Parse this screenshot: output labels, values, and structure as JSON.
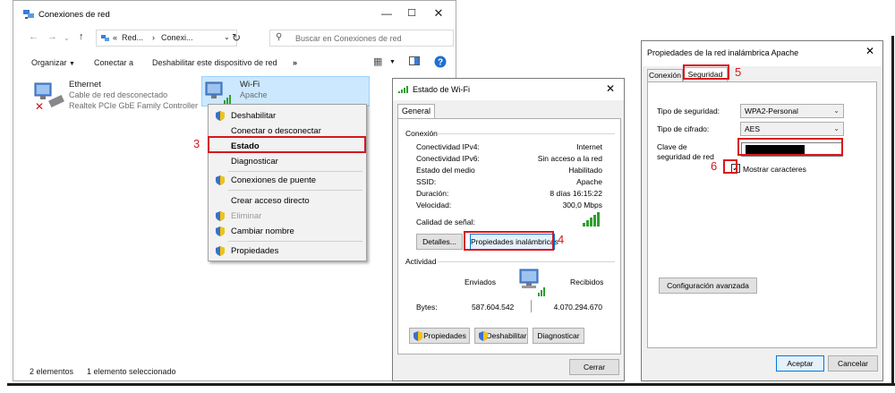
{
  "explorer": {
    "title": "Conexiones de red",
    "address": {
      "segment1": "Red...",
      "segment2": "Conexi...",
      "prefix": "«"
    },
    "search": {
      "placeholder": "Buscar en Conexiones de red"
    },
    "toolbar": {
      "organize": "Organizar",
      "connect": "Conectar a",
      "disable": "Deshabilitar este dispositivo de red",
      "more": "»"
    },
    "items": [
      {
        "name": "Ethernet",
        "line1": "Cable de red desconectado",
        "line2": "Realtek PCIe GbE Family Controller"
      },
      {
        "name": "Wi-Fi",
        "line1": "Apache"
      }
    ],
    "status": {
      "count": "2 elementos",
      "selected": "1 elemento seleccionado"
    }
  },
  "context_menu": {
    "items": [
      {
        "label": "Deshabilitar",
        "shield": true
      },
      {
        "label": "Conectar o desconectar"
      },
      {
        "label": "Estado",
        "bold": true
      },
      {
        "label": "Diagnosticar"
      },
      {
        "label": "Conexiones de puente",
        "shield": true
      },
      {
        "label": "Crear acceso directo"
      },
      {
        "label": "Eliminar",
        "shield": true,
        "disabled": true
      },
      {
        "label": "Cambiar nombre",
        "shield": true
      },
      {
        "label": "Propiedades",
        "shield": true
      }
    ]
  },
  "estado": {
    "title": "Estado de Wi-Fi",
    "tab": "General",
    "group_connection": "Conexión",
    "rows": [
      {
        "label": "Conectividad IPv4:",
        "value": "Internet"
      },
      {
        "label": "Conectividad IPv6:",
        "value": "Sin acceso a la red"
      },
      {
        "label": "Estado del medio",
        "value": "Habilitado"
      },
      {
        "label": "SSID:",
        "value": "Apache"
      },
      {
        "label": "Duración:",
        "value": "8 días 16:15:22"
      },
      {
        "label": "Velocidad:",
        "value": "300,0 Mbps"
      }
    ],
    "signal_label": "Calidad de señal:",
    "details_button": "Detalles...",
    "wireless_props_button": "Propiedades inalámbricas",
    "group_activity": "Actividad",
    "sent_label": "Enviados",
    "received_label": "Recibidos",
    "bytes_label": "Bytes:",
    "bytes_sent": "587.604.542",
    "bytes_received": "4.070.294.670",
    "props_button": "Propiedades",
    "disable_button": "Deshabilitar",
    "diagnose_button": "Diagnosticar",
    "close_button": "Cerrar"
  },
  "props": {
    "title": "Propiedades de la red inalámbrica Apache",
    "tab_connection": "Conexión",
    "tab_security": "Seguridad",
    "security_type_label": "Tipo de seguridad:",
    "security_type_value": "WPA2-Personal",
    "cipher_label": "Tipo de cifrado:",
    "cipher_value": "AES",
    "key_label": "Clave de seguridad de red",
    "show_chars_label": "Mostrar caracteres",
    "advanced_button": "Configuración avanzada",
    "accept_button": "Aceptar",
    "cancel_button": "Cancelar"
  },
  "annotations": {
    "step3": "3",
    "step4": "4",
    "step5": "5",
    "step6": "6"
  },
  "colors": {
    "highlight_red": "#d9161e",
    "selection_blue": "#cce8ff",
    "accent_blue": "#0078d7"
  }
}
